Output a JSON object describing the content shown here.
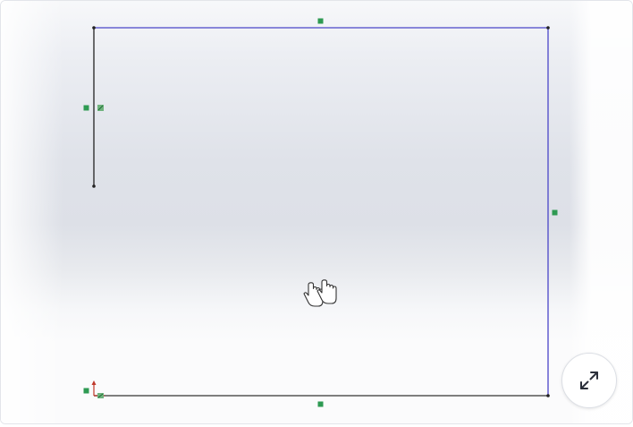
{
  "viewer": {
    "background": "#e1e4ea",
    "sketch_line_color": "#4a45c8",
    "construction_line_color": "#222222",
    "relation_marker_color": "#2e9a52",
    "origin_marker_color": "#c0392b"
  },
  "expand_button": {
    "icon": "expand-arrows-icon"
  },
  "cursor": {
    "icon": "hand-grab-icon"
  }
}
